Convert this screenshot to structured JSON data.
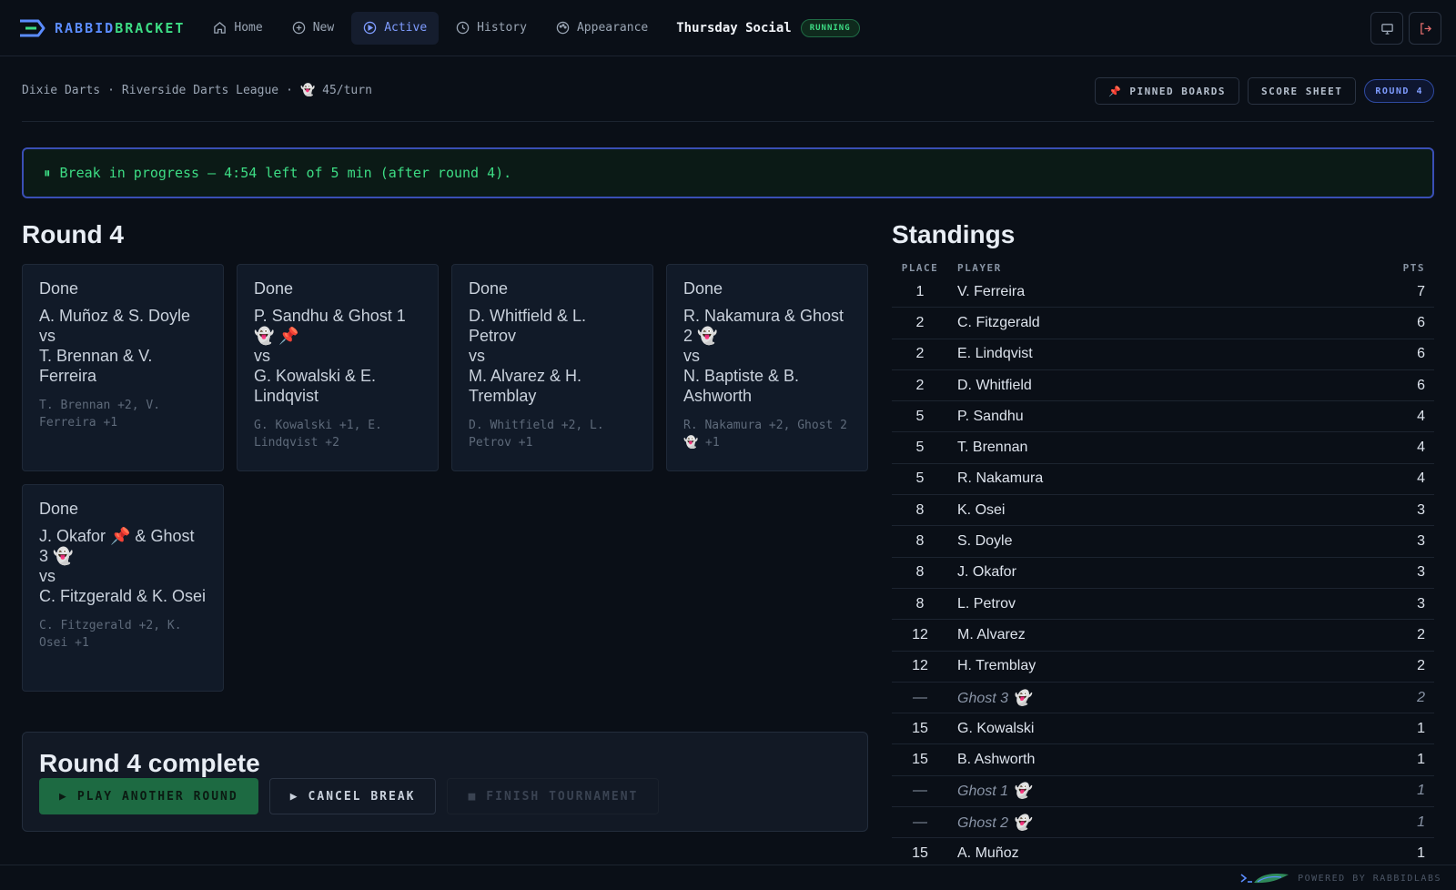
{
  "brand": {
    "name_a": "RABBID",
    "name_b": "BRACKET"
  },
  "nav": [
    {
      "label": "Home",
      "icon": "home-icon"
    },
    {
      "label": "New",
      "icon": "plus-circle-icon"
    },
    {
      "label": "Active",
      "icon": "play-circle-icon",
      "active": true
    },
    {
      "label": "History",
      "icon": "clock-icon"
    },
    {
      "label": "Appearance",
      "icon": "palette-icon"
    }
  ],
  "tournament": {
    "title": "Thursday Social",
    "status": "RUNNING"
  },
  "top_actions": [
    "monitor-icon",
    "logout-icon"
  ],
  "breadcrumb": {
    "game": "Dixie Darts",
    "sep1": "·",
    "league": "Riverside Darts League",
    "sep2": "·",
    "ghost_icon": "👻",
    "rate": "45/turn"
  },
  "sub_actions": {
    "pinned_icon": "📌",
    "pinned": "PINNED BOARDS",
    "score_sheet": "SCORE SHEET",
    "round": "ROUND 4"
  },
  "banner": {
    "icon": "⏸",
    "text": "Break in progress — 4:54 left of 5 min (after round 4)."
  },
  "round": {
    "title": "Round 4",
    "matches": [
      {
        "status": "Done",
        "team_a": "A. Muñoz & S. Doyle",
        "vs": "vs",
        "team_b": "T. Brennan & V. Ferreira",
        "result": "T. Brennan +2, V. Ferreira +1"
      },
      {
        "status": "Done",
        "team_a": "P. Sandhu & Ghost 1 👻 📌",
        "vs": "vs",
        "team_b": "G. Kowalski & E. Lindqvist",
        "result": "G. Kowalski +1, E. Lindqvist +2"
      },
      {
        "status": "Done",
        "team_a": "D. Whitfield & L. Petrov",
        "vs": "vs",
        "team_b": "M. Alvarez & H. Tremblay",
        "result": "D. Whitfield +2, L. Petrov +1"
      },
      {
        "status": "Done",
        "team_a": "R. Nakamura & Ghost 2 👻",
        "vs": "vs",
        "team_b": "N. Baptiste & B. Ashworth",
        "result": "R. Nakamura +2, Ghost 2 👻 +1"
      },
      {
        "status": "Done",
        "team_a": "J. Okafor 📌 & Ghost 3 👻",
        "vs": "vs",
        "team_b": "C. Fitzgerald & K. Osei",
        "result": "C. Fitzgerald +2, K. Osei +1"
      }
    ]
  },
  "complete": {
    "title": "Round 4 complete",
    "play_icon": "▶",
    "play": "PLAY ANOTHER ROUND",
    "cancel_icon": "▶",
    "cancel": "CANCEL BREAK",
    "finish_icon": "■",
    "finish": "FINISH TOURNAMENT"
  },
  "standings": {
    "title": "Standings",
    "headers": {
      "place": "PLACE",
      "player": "PLAYER",
      "pts": "PTS"
    },
    "rows": [
      {
        "place": "1",
        "player": "V. Ferreira",
        "pts": "7"
      },
      {
        "place": "2",
        "player": "C. Fitzgerald",
        "pts": "6"
      },
      {
        "place": "2",
        "player": "E. Lindqvist",
        "pts": "6"
      },
      {
        "place": "2",
        "player": "D. Whitfield",
        "pts": "6"
      },
      {
        "place": "5",
        "player": "P. Sandhu",
        "pts": "4"
      },
      {
        "place": "5",
        "player": "T. Brennan",
        "pts": "4"
      },
      {
        "place": "5",
        "player": "R. Nakamura",
        "pts": "4"
      },
      {
        "place": "8",
        "player": "K. Osei",
        "pts": "3"
      },
      {
        "place": "8",
        "player": "S. Doyle",
        "pts": "3"
      },
      {
        "place": "8",
        "player": "J. Okafor",
        "pts": "3"
      },
      {
        "place": "8",
        "player": "L. Petrov",
        "pts": "3"
      },
      {
        "place": "12",
        "player": "M. Alvarez",
        "pts": "2"
      },
      {
        "place": "12",
        "player": "H. Tremblay",
        "pts": "2"
      },
      {
        "place": "—",
        "player": "Ghost 3 👻",
        "pts": "2",
        "ghost": true
      },
      {
        "place": "15",
        "player": "G. Kowalski",
        "pts": "1"
      },
      {
        "place": "15",
        "player": "B. Ashworth",
        "pts": "1"
      },
      {
        "place": "—",
        "player": "Ghost 1 👻",
        "pts": "1",
        "ghost": true
      },
      {
        "place": "—",
        "player": "Ghost 2 👻",
        "pts": "1",
        "ghost": true
      },
      {
        "place": "15",
        "player": "A. Muñoz",
        "pts": "1"
      }
    ]
  },
  "footer": {
    "powered": "POWERED BY RABBIDLABS"
  },
  "colors": {
    "accent": "#5b8cff",
    "green": "#3ddc84",
    "bg": "#0a0f17",
    "card": "#111a28"
  }
}
